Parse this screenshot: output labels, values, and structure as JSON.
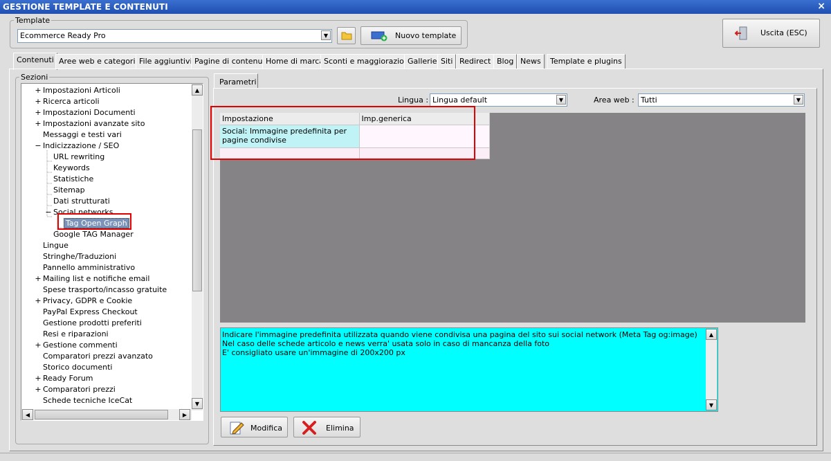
{
  "window": {
    "title": "GESTIONE TEMPLATE E CONTENUTI",
    "close": "×"
  },
  "template_group": {
    "label": "Template",
    "selected": "Ecommerce Ready Pro",
    "new_button": "Nuovo template"
  },
  "exit_button": "Uscita (ESC)",
  "tabs": [
    "Contenuti",
    "Aree web e categorie",
    "File aggiuntivi",
    "Pagine di contenuti",
    "Home di marca",
    "Sconti e maggiorazioni",
    "Gallerie",
    "Siti",
    "Redirect",
    "Blog",
    "News",
    "Template e plugins"
  ],
  "active_tab": "Contenuti",
  "sections": {
    "label": "Sezioni",
    "items": [
      {
        "label": "Impostazioni Articoli",
        "expander": "+"
      },
      {
        "label": "Ricerca articoli",
        "expander": "+"
      },
      {
        "label": "Impostazioni Documenti",
        "expander": "+"
      },
      {
        "label": "Impostazioni avanzate sito",
        "expander": "+"
      },
      {
        "label": "Messaggi e testi vari",
        "expander": ""
      },
      {
        "label": "Indicizzazione / SEO",
        "expander": "−"
      },
      {
        "label": "URL rewriting",
        "expander": ""
      },
      {
        "label": "Keywords",
        "expander": ""
      },
      {
        "label": "Statistiche",
        "expander": ""
      },
      {
        "label": "Sitemap",
        "expander": ""
      },
      {
        "label": "Dati strutturati",
        "expander": ""
      },
      {
        "label": "Social networks",
        "expander": "−"
      },
      {
        "label": "Tag Open Graph",
        "expander": ""
      },
      {
        "label": "Google TAG Manager",
        "expander": ""
      },
      {
        "label": "Lingue",
        "expander": ""
      },
      {
        "label": "Stringhe/Traduzioni",
        "expander": ""
      },
      {
        "label": "Pannello amministrativo",
        "expander": ""
      },
      {
        "label": "Mailing list e notifiche email",
        "expander": "+"
      },
      {
        "label": "Spese trasporto/incasso gratuite",
        "expander": ""
      },
      {
        "label": "Privacy, GDPR e Cookie",
        "expander": "+"
      },
      {
        "label": "PayPal Express Checkout",
        "expander": ""
      },
      {
        "label": "Gestione prodotti preferiti",
        "expander": ""
      },
      {
        "label": "Resi e riparazioni",
        "expander": ""
      },
      {
        "label": "Gestione commenti",
        "expander": "+"
      },
      {
        "label": "Comparatori prezzi avanzato",
        "expander": ""
      },
      {
        "label": "Storico documenti",
        "expander": ""
      },
      {
        "label": "Ready Forum",
        "expander": "+"
      },
      {
        "label": "Comparatori prezzi",
        "expander": "+"
      },
      {
        "label": "Schede tecniche IceCat",
        "expander": ""
      }
    ]
  },
  "params": {
    "tab": "Parametri",
    "lingua_label": "Lingua :",
    "lingua_value": "Lingua default",
    "area_label": "Area web :",
    "area_value": "Tutti",
    "grid_headers": [
      "Impostazione",
      "Imp.generica"
    ],
    "grid_row": {
      "impostazione": "Social: Immagine predefinita per pagine condivise",
      "valore": ""
    },
    "description": [
      "Indicare l'immagine predefinita utilizzata quando viene condivisa una pagina del sito sui social network (Meta Tag og:image)",
      "Nel caso delle schede articolo e news verra' usata solo in caso di mancanza della foto",
      "E' consigliato usare un'immagine di 200x200 px"
    ],
    "modify_button": "Modifica",
    "delete_button": "Elimina"
  }
}
